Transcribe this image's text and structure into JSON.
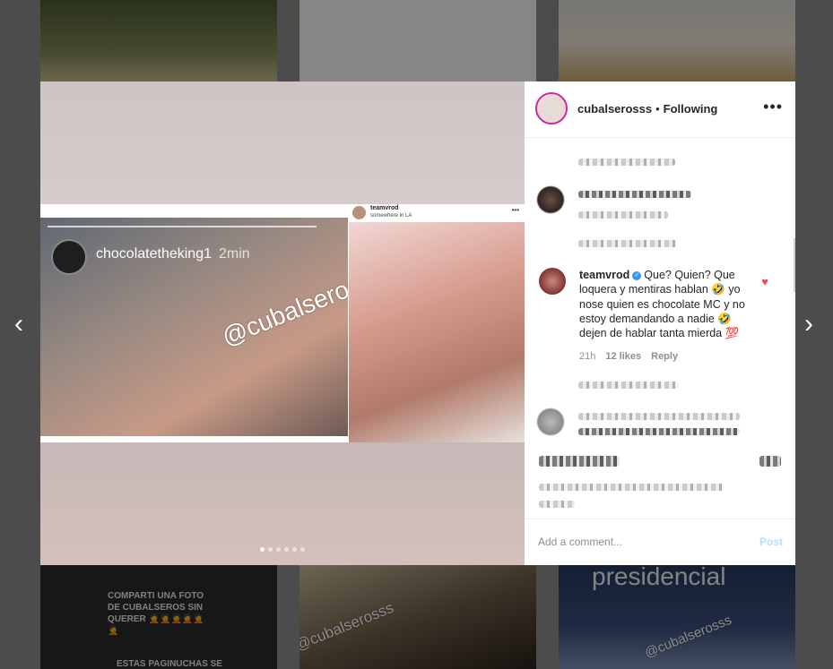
{
  "post": {
    "username": "cubalserosss",
    "separator": "•",
    "follow_status": "Following",
    "more_icon": "more-horizontal-icon"
  },
  "media": {
    "story_username": "chocolatetheking1",
    "story_time": "2min",
    "watermark": "@cubalserosss",
    "inner_post_user": "teamvrod",
    "inner_post_location": "somewhere in LA",
    "carousel_count": 6,
    "carousel_active": 0
  },
  "comment": {
    "username": "teamvrod",
    "text": "Que? Quien? Que loquera y mentiras hablan 🤣 yo nose quien es chocolate MC y no estoy demandando a nadie 🤣 dejen de hablar tanta mierda 💯",
    "time": "21h",
    "likes": "12 likes",
    "reply": "Reply"
  },
  "composer": {
    "placeholder": "Add a comment...",
    "post_label": "Post"
  },
  "background": {
    "tile_d_text": "COMPARTI UNA FOTO DE CUBALSEROS SIN QUERER 🤦🤦🤦🤦🤦🤦",
    "tile_d_text2": "ESTAS PAGINUCHAS SE",
    "tile_f_text": "presidencial",
    "tile_e_watermark": "@cubalserosss",
    "tile_f_watermark": "@cubalserosss"
  },
  "nav": {
    "prev": "‹",
    "next": "›"
  },
  "colors": {
    "verified": "#3897f0",
    "heart": "#ed4956",
    "post_button": "#b2dffc"
  }
}
